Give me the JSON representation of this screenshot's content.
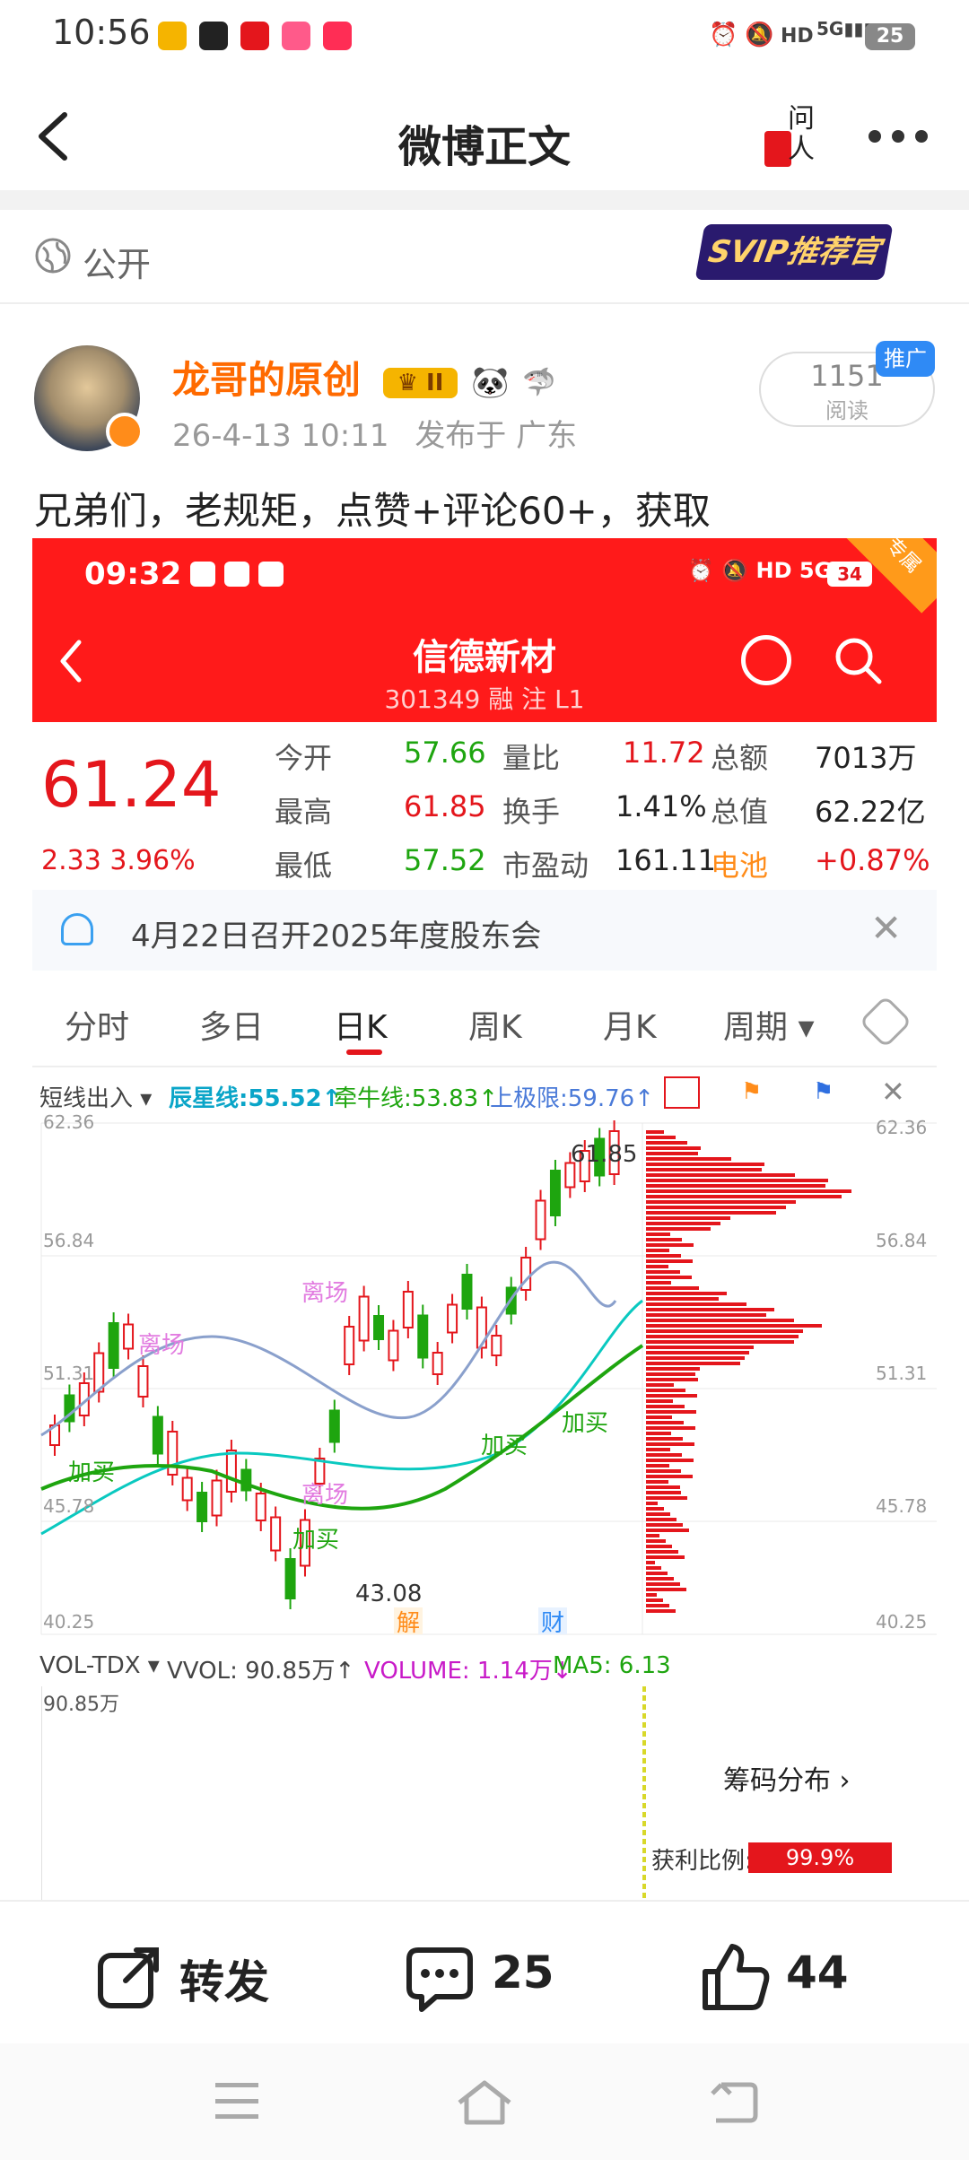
{
  "status_bar": {
    "time": "10:56",
    "network": "5G",
    "battery": "25"
  },
  "nav": {
    "title": "微博正文",
    "ask_icon_text": "问人"
  },
  "visibility": {
    "label": "公开"
  },
  "badge": {
    "svip": "SVIP推荐官"
  },
  "post": {
    "author": "龙哥的原创",
    "level": "II",
    "time": "26-4-13 10:11",
    "location": "发布于 广东",
    "read_count": "1151",
    "read_label": "阅读",
    "promo": "推广",
    "text": "兄弟们，老规矩，点赞+评论60+，获取"
  },
  "screenshot": {
    "time": "09:32",
    "battery": "34",
    "corner": "专属",
    "stock_name": "信德新材",
    "stock_code": "301349 融 注 L1",
    "price": "61.24",
    "change": "2.33 3.96%",
    "quote": [
      {
        "label": "今开",
        "value": "57.66",
        "label2": "量比",
        "value2": "11.72",
        "label3": "总额",
        "value3": "7013万"
      },
      {
        "label": "最高",
        "value": "61.85",
        "label2": "换手",
        "value2": "1.41%",
        "label3": "总值",
        "value3": "62.22亿"
      },
      {
        "label": "最低",
        "value": "57.52",
        "label2": "市盈动",
        "value2": "161.11",
        "label3": "电池",
        "value3": "+0.87%"
      }
    ],
    "notice": "4月22日召开2025年度股东会",
    "tabs": [
      "分时",
      "多日",
      "日K",
      "周K",
      "月K",
      "周期"
    ],
    "active_tab": "日K",
    "indicator": {
      "name": "短线出入",
      "l1": "辰星线:55.52↑",
      "l2": "牵牛线:53.83↑",
      "l3": "上极限:59.76↑"
    },
    "y_ticks": [
      "62.36",
      "56.84",
      "51.31",
      "45.78",
      "40.25"
    ],
    "chart_labels": {
      "high": "61.85",
      "low": "43.08",
      "jie": "解",
      "cai": "财",
      "lichang": "离场",
      "jiamai": "加买"
    },
    "volume": {
      "name": "VOL-TDX",
      "vvol": "VVOL: 90.85万↑",
      "volume": "VOLUME: 1.14万↓",
      "ma5": "MA5: 6.13",
      "axis_top": "90.85万"
    },
    "chips": {
      "title": "筹码分布",
      "profit_label": "获利比例:",
      "profit_value": "99.9%"
    }
  },
  "actions": {
    "repost": "转发",
    "comments": "25",
    "likes": "44"
  },
  "colors": {
    "red": "#e4161c",
    "green": "#1ea50f",
    "orange": "#ff6a00"
  }
}
